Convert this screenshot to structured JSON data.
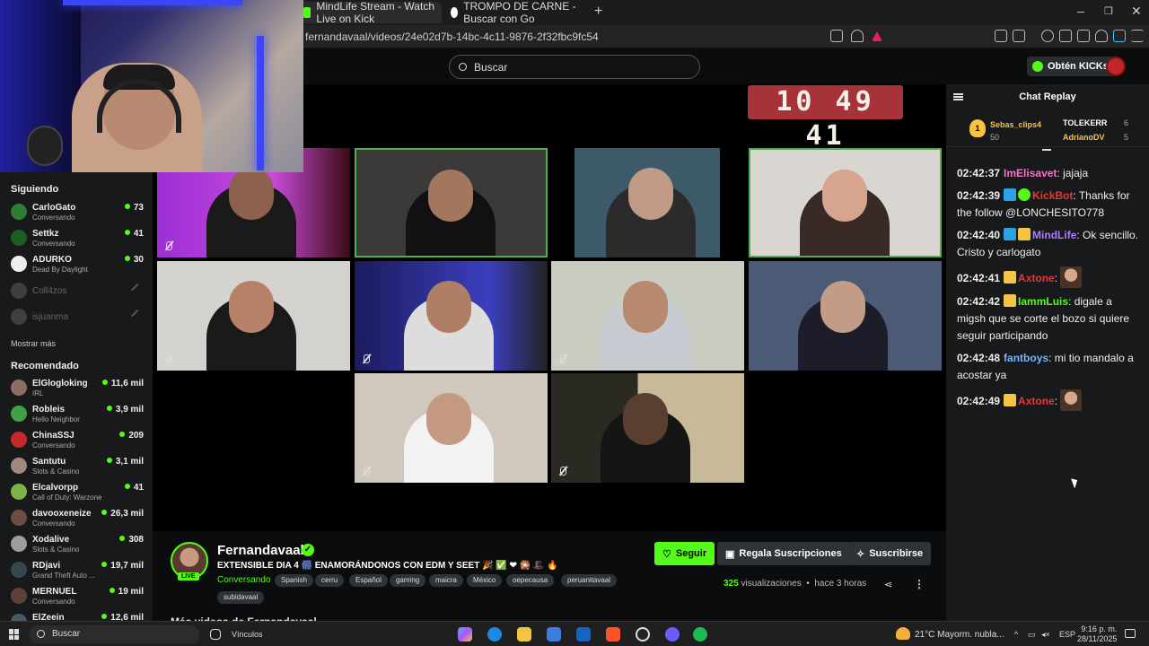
{
  "browser": {
    "tabs": [
      {
        "label": "MindLife Stream - Watch Live on Kick"
      },
      {
        "label": "TROMPO DE CARNE - Buscar con Go"
      }
    ],
    "url": "fernandavaal/videos/24e02d7b-14bc-4c11-9876-2f32fbc9fc54"
  },
  "header": {
    "search_placeholder": "Buscar",
    "kicks_label": "Obtén KICKs"
  },
  "timer": "10 49 41",
  "sidebar": {
    "following_heading": "Siguiendo",
    "following": [
      {
        "name": "CarloGato",
        "category": "Conversando",
        "viewers": "73",
        "avatar_color": "#2e7d32"
      },
      {
        "name": "Settkz",
        "category": "Conversando",
        "viewers": "41",
        "avatar_color": "#1b5e20"
      },
      {
        "name": "ADURKO",
        "category": "Dead By Daylight",
        "viewers": "30",
        "avatar_color": "#111111"
      },
      {
        "name": "Coll4zos",
        "offline": true,
        "avatar_color": "#555555"
      },
      {
        "name": "isjuanma",
        "offline": true,
        "avatar_color": "#555555"
      }
    ],
    "show_more": "Mostrar más",
    "recommended_heading": "Recomendado",
    "recommended": [
      {
        "name": "ElGlogloking",
        "category": "IRL",
        "viewers": "11,6 mil",
        "avatar_color": "#8d6e63"
      },
      {
        "name": "Robleis",
        "category": "Hello Neighbor",
        "viewers": "3,9 mil",
        "avatar_color": "#43a047"
      },
      {
        "name": "ChinaSSJ",
        "category": "Conversando",
        "viewers": "209",
        "avatar_color": "#c62828"
      },
      {
        "name": "Santutu",
        "category": "Slots & Casino",
        "viewers": "3,1 mil",
        "avatar_color": "#a1887f"
      },
      {
        "name": "Elcalvorpp",
        "category": "Call of Duty: Warzone",
        "viewers": "41",
        "avatar_color": "#7cb342"
      },
      {
        "name": "davooxeneize",
        "category": "Conversando",
        "viewers": "26,3 mil",
        "avatar_color": "#6d4c41"
      },
      {
        "name": "Xodalive",
        "category": "Slots & Casino",
        "viewers": "308",
        "avatar_color": "#9e9e9e"
      },
      {
        "name": "RDjavi",
        "category": "Grand Theft Auto ...",
        "viewers": "19,7 mil",
        "avatar_color": "#37474f"
      },
      {
        "name": "MERNUEL",
        "category": "Conversando",
        "viewers": "19 mil",
        "avatar_color": "#5d4037"
      },
      {
        "name": "ElZeein",
        "category": "",
        "viewers": "12,6 mil",
        "avatar_color": "#455a64"
      }
    ]
  },
  "stream": {
    "channel": "Fernandavaal",
    "live_badge": "LIVE",
    "title": "EXTENSIBLE DIA 4 🎆 ENAMORÁNDONOS CON EDM Y SEET 🎉 ✅ ❤ 🎇 🎩 🔥",
    "category": "Conversando",
    "tags": [
      "Spanish",
      "cerru",
      "Español",
      "gaming",
      "maicra",
      "México",
      "oepecausa",
      "peruanitavaal",
      "subidavaal"
    ],
    "follow_label": "Seguir",
    "gift_label": "Regala Suscripciones",
    "subscribe_label": "Suscribirse",
    "views_count": "325",
    "views_label": "visualizaciones",
    "time_ago": "hace 3 horas",
    "more_videos": "Más videos de Fernandavaal"
  },
  "chat": {
    "title": "Chat Replay",
    "top_gifters": [
      {
        "rank": "1",
        "name": "Sebas_clips4",
        "value": "50",
        "color": "#f6c343"
      },
      {
        "name": "TOLEKERR",
        "value": "6",
        "color": "#ffffff"
      },
      {
        "name": "AdrianoDV",
        "value": "5",
        "color": "#f6c343"
      }
    ],
    "messages": [
      {
        "time": "02:42:37",
        "user": "ImElisavet",
        "color": "#ff6ec7",
        "text": "jajaja"
      },
      {
        "time": "02:42:39",
        "user": "KickBot",
        "color": "#e53935",
        "text": "Thanks for the follow @LONCHESITO778"
      },
      {
        "time": "02:42:40",
        "user": "MindLife",
        "color": "#b07cff",
        "text": "Ok sencillo. Cristo y carlogato"
      },
      {
        "time": "02:42:41",
        "user": "Axtone",
        "color": "#e53935",
        "text": ""
      },
      {
        "time": "02:42:42",
        "user": "IammLuis",
        "color": "#53fc18",
        "text": "digale a migsh que se corte el bozo si quiere seguir participando"
      },
      {
        "time": "02:42:48",
        "user": "fantboys",
        "color": "#6fb7ff",
        "text": "mi tio mandalo a acostar ya"
      },
      {
        "time": "02:42:49",
        "user": "Axtone",
        "color": "#e53935",
        "text": ""
      }
    ]
  },
  "taskbar": {
    "search": "Buscar",
    "links": "Vínculos",
    "weather": "21°C  Mayorm. nubla...",
    "lang": "ESP",
    "time": "9:16 p. m.",
    "date": "28/11/2025"
  }
}
